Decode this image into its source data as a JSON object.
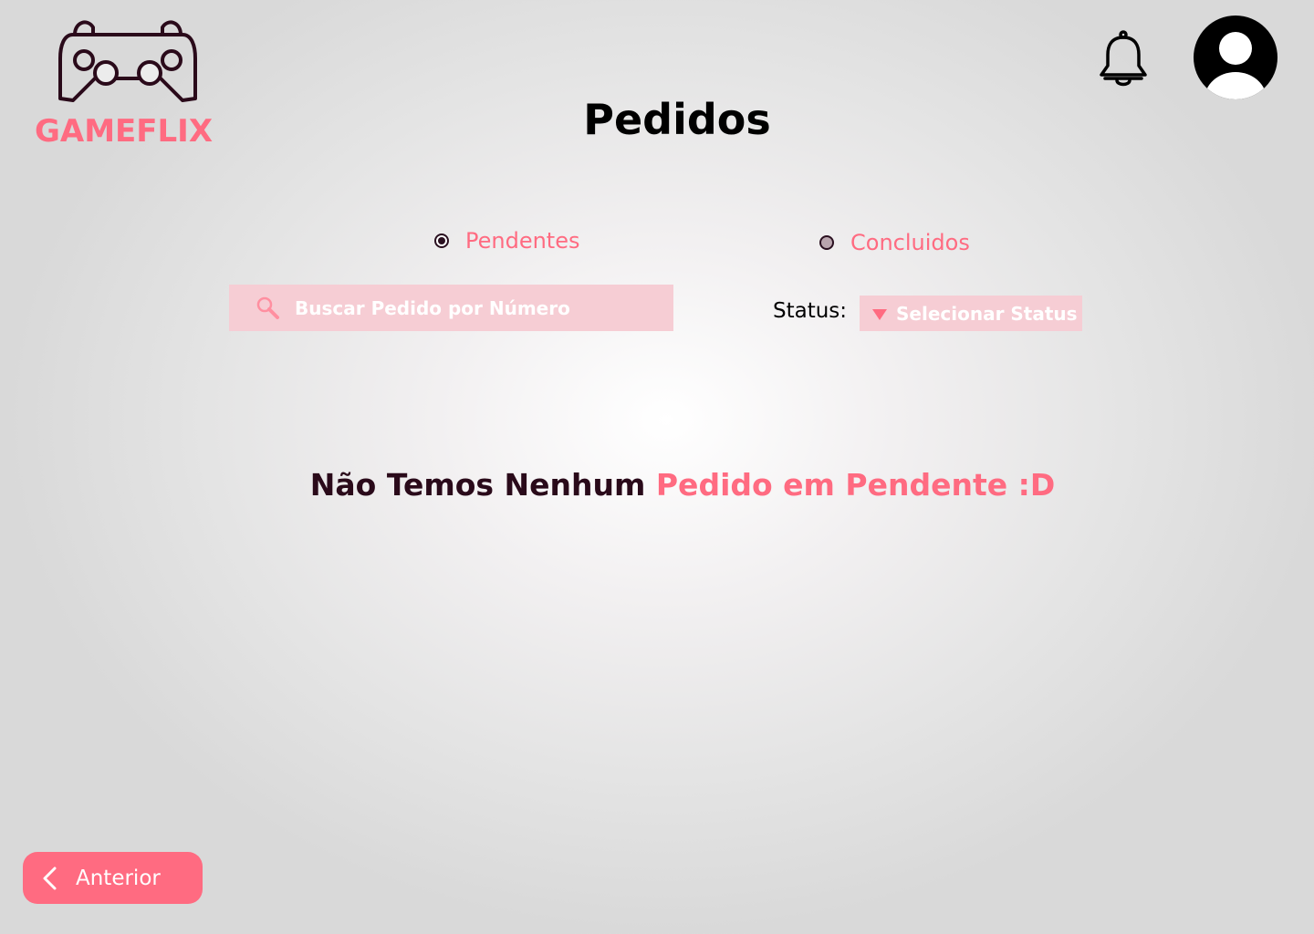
{
  "brand": {
    "name": "GAMEFLIX",
    "logo_icon": "gamepad-icon",
    "accent_color": "#ff6b81",
    "dark_color": "#2a0a1a"
  },
  "header": {
    "title": "Pedidos",
    "notifications_icon": "bell-icon",
    "profile_icon": "user-avatar-icon"
  },
  "filters": {
    "tabs": [
      {
        "label": "Pendentes",
        "selected": true
      },
      {
        "label": "Concluidos",
        "selected": false
      }
    ],
    "search": {
      "placeholder": "Buscar Pedido por Número",
      "icon": "search-icon"
    },
    "status": {
      "label": "Status:",
      "selected": "Selecionar Status"
    }
  },
  "empty_state": {
    "part1": "Não Temos Nenhum",
    "part2": "Pedido em Pendente",
    "part3": ":D"
  },
  "footer": {
    "back_label": "Anterior"
  }
}
